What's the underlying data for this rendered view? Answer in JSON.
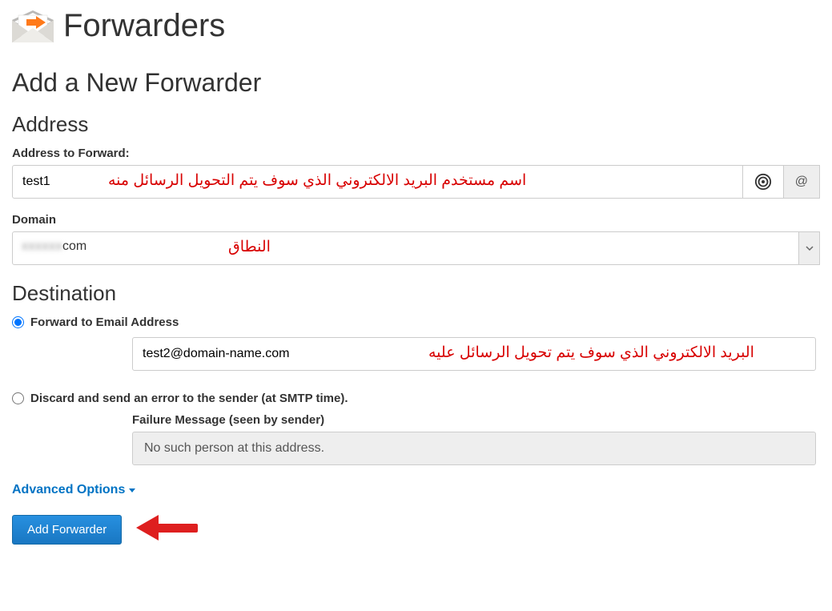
{
  "header": {
    "title": "Forwarders"
  },
  "section": {
    "title": "Add a New Forwarder"
  },
  "address": {
    "title": "Address",
    "to_forward_label": "Address to Forward:",
    "to_forward_value": "test1",
    "at_symbol": "@",
    "domain_label": "Domain",
    "domain_value_suffix": "com"
  },
  "destination": {
    "title": "Destination",
    "forward_label": "Forward to Email Address",
    "forward_value": "test2@domain-name.com",
    "discard_label": "Discard and send an error to the sender (at SMTP time).",
    "failure_label": "Failure Message (seen by sender)",
    "failure_value": "No such person at this address."
  },
  "advanced": {
    "label": "Advanced Options"
  },
  "submit": {
    "label": "Add Forwarder"
  },
  "annotations": {
    "address_note": "اسم مستخدم البريد الالكتروني الذي سوف يتم التحويل الرسائل منه",
    "domain_note": "النطاق",
    "destination_note": "البريد الالكتروني الذي سوف يتم تحويل الرسائل عليه"
  }
}
